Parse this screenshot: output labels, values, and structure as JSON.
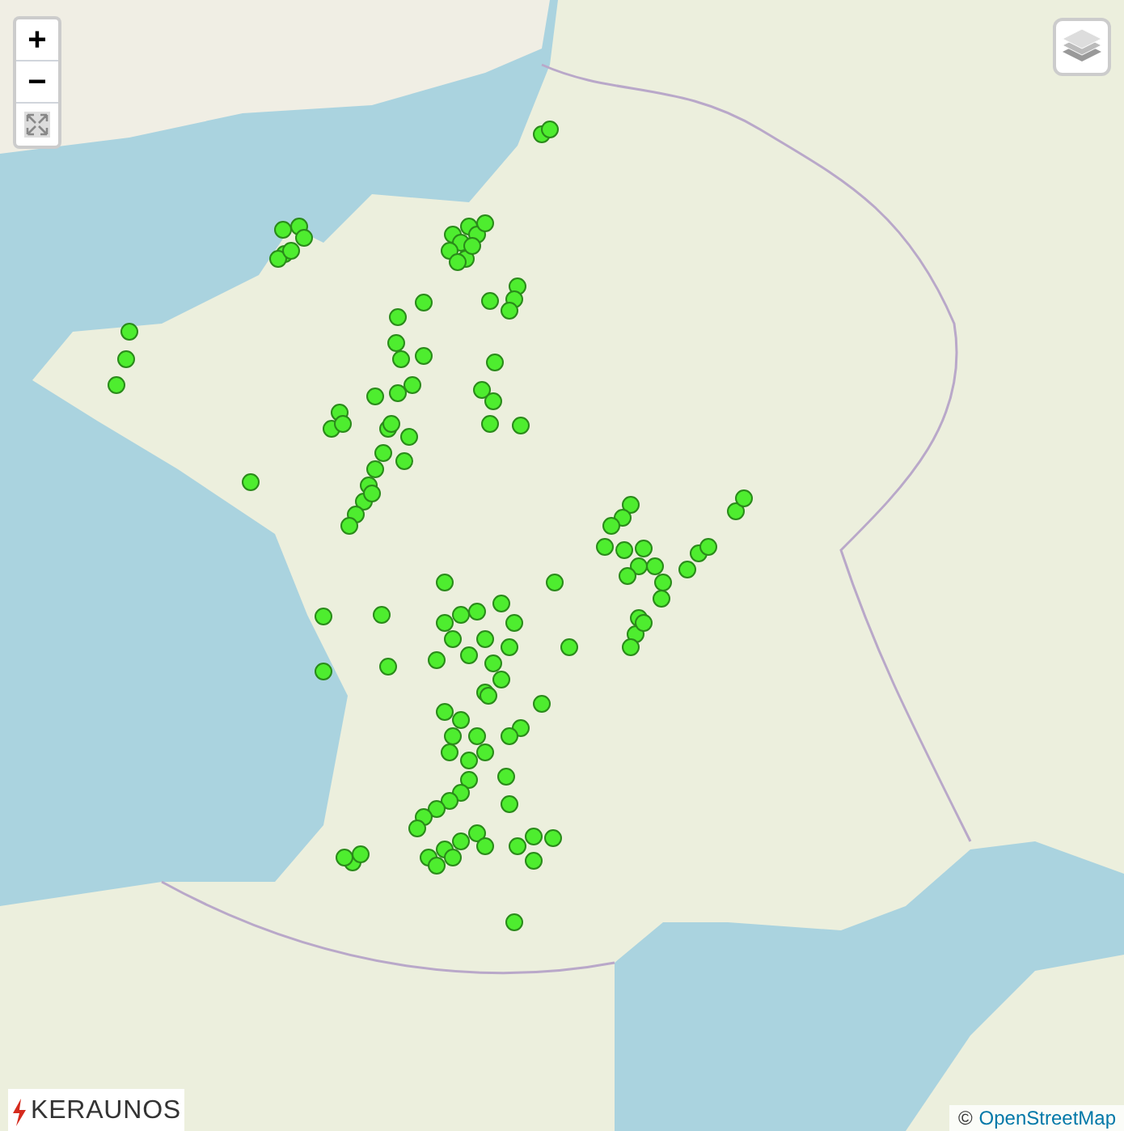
{
  "zoom_controls": {
    "zoom_in": "+",
    "zoom_out": "−"
  },
  "logo": {
    "text": "KERAUNOS"
  },
  "attribution": {
    "symbol": "©",
    "link": "OpenStreetMap"
  }
}
